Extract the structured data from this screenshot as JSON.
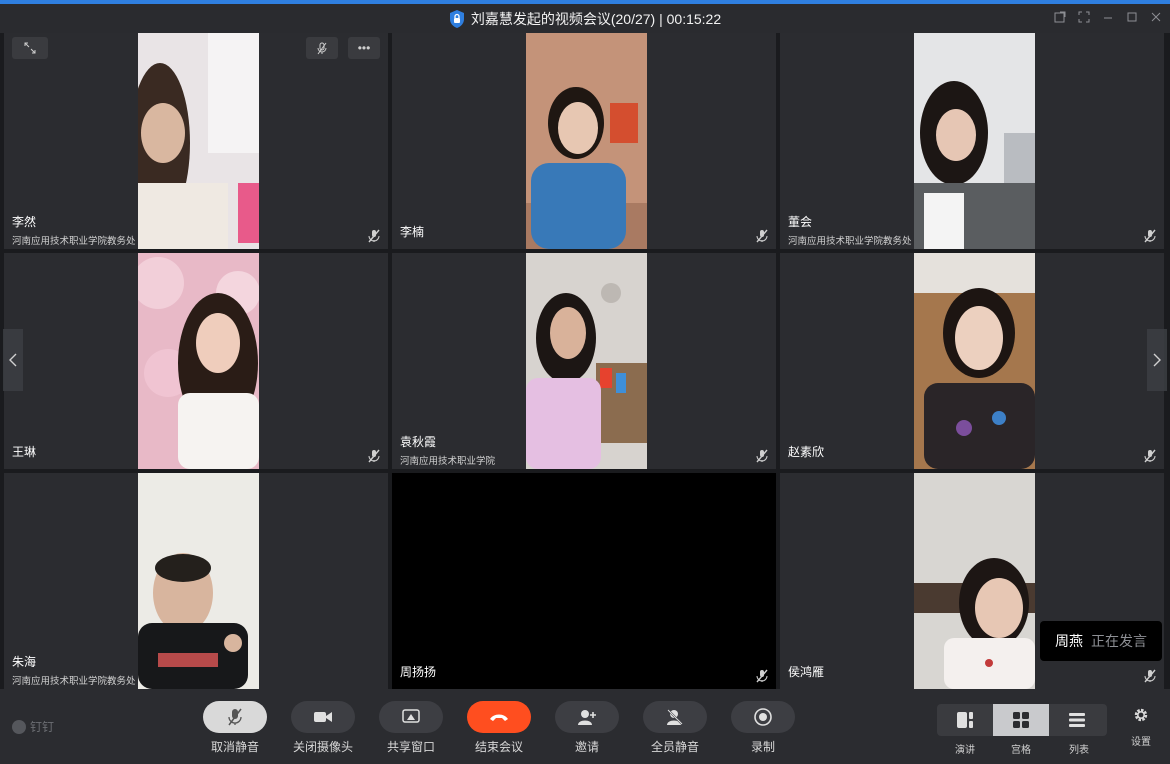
{
  "window": {
    "title": "刘嘉慧发起的视频会议(20/27) | 00:15:22"
  },
  "participants": [
    {
      "name": "李然",
      "org": "河南应用技术职业学院教务处"
    },
    {
      "name": "李楠",
      "org": ""
    },
    {
      "name": "董会",
      "org": "河南应用技术职业学院教务处"
    },
    {
      "name": "王琳",
      "org": ""
    },
    {
      "name": "袁秋霞",
      "org": "河南应用技术职业学院"
    },
    {
      "name": "赵素欣",
      "org": ""
    },
    {
      "name": "朱海",
      "org": "河南应用技术职业学院教务处"
    },
    {
      "name": "周扬扬",
      "org": ""
    },
    {
      "name": "侯鸿雁",
      "org": ""
    }
  ],
  "speaking": {
    "name": "周燕",
    "status": "正在发言"
  },
  "brand": {
    "name": "钉钉"
  },
  "controls": [
    {
      "label": "取消静音",
      "icon": "mic-off-icon"
    },
    {
      "label": "关闭摄像头",
      "icon": "camera-icon"
    },
    {
      "label": "共享窗口",
      "icon": "share-screen-icon"
    },
    {
      "label": "结束会议",
      "icon": "hangup-icon"
    },
    {
      "label": "邀请",
      "icon": "invite-icon"
    },
    {
      "label": "全员静音",
      "icon": "mute-all-icon"
    },
    {
      "label": "录制",
      "icon": "record-icon"
    }
  ],
  "layouts": [
    {
      "label": "演讲",
      "icon": "speaker-layout-icon"
    },
    {
      "label": "宫格",
      "icon": "grid-layout-icon",
      "selected": true
    },
    {
      "label": "列表",
      "icon": "list-layout-icon"
    }
  ],
  "settings": {
    "label": "设置",
    "icon": "gear-icon"
  },
  "colors": {
    "accent": "#2f7fe0",
    "hangup": "#ff4e1f",
    "background": "#2b2c30"
  }
}
